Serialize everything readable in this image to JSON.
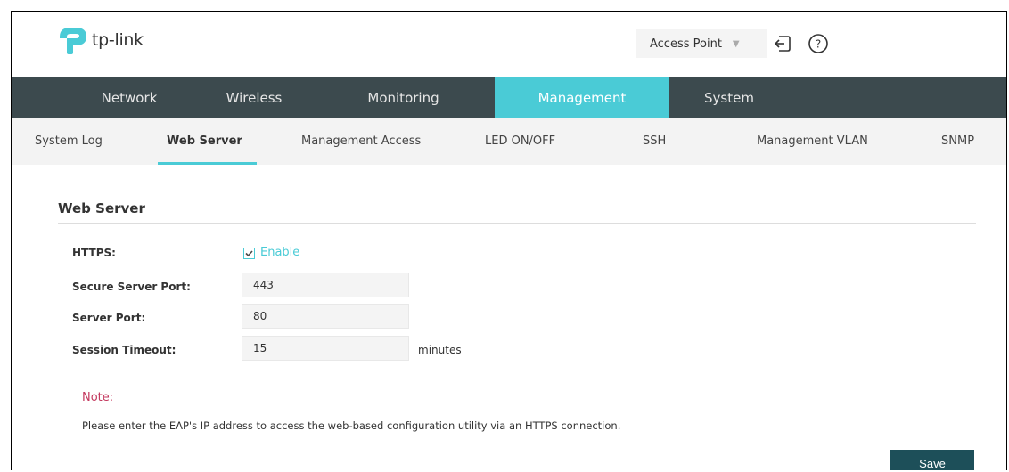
{
  "header": {
    "logo_text": "tp-link",
    "mode_select": "Access Point",
    "icons": [
      "logout-icon",
      "help-icon"
    ],
    "brand_color": "#4acbd6"
  },
  "main_nav": {
    "tabs": [
      {
        "label": "Network"
      },
      {
        "label": "Wireless"
      },
      {
        "label": "Monitoring"
      },
      {
        "label": "Management"
      },
      {
        "label": "System"
      }
    ],
    "active": "Management"
  },
  "sub_nav": {
    "tabs": [
      {
        "label": "System Log"
      },
      {
        "label": "Web Server"
      },
      {
        "label": "Management Access"
      },
      {
        "label": "LED ON/OFF"
      },
      {
        "label": "SSH"
      },
      {
        "label": "Management VLAN"
      },
      {
        "label": "SNMP"
      }
    ],
    "active": "Web Server"
  },
  "section": {
    "title": "Web Server"
  },
  "form": {
    "https_label": "HTTPS:",
    "https_checkbox_label": "Enable",
    "https_checked": true,
    "secure_port_label": "Secure Server Port:",
    "secure_port_value": "443",
    "server_port_label": "Server Port:",
    "server_port_value": "80",
    "session_timeout_label": "Session Timeout:",
    "session_timeout_value": "15",
    "session_timeout_unit": "minutes"
  },
  "note": {
    "title": "Note:",
    "text": "Please enter the EAP's IP address to access the web-based configuration utility via an HTTPS connection."
  },
  "actions": {
    "save_label": "Save"
  }
}
